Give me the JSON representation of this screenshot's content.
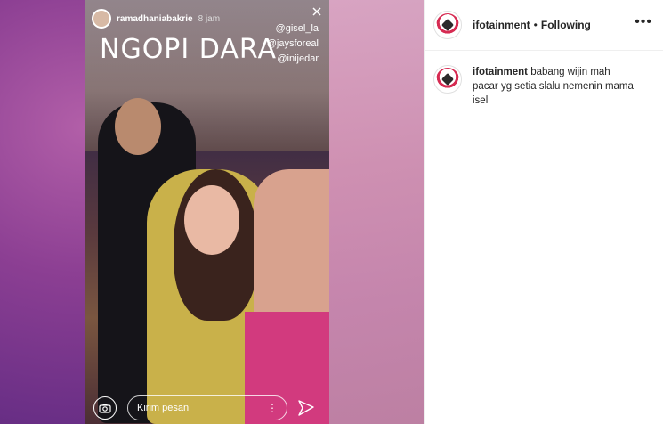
{
  "story": {
    "username": "ramadhaniabakrie",
    "time": "8 jam",
    "title": "NGOPI DARA",
    "tags": [
      "@gisel_la",
      "@jaysforeal",
      "@inijedar"
    ],
    "message_placeholder": "Kirim pesan"
  },
  "post": {
    "account": "ifotainment",
    "separator": "•",
    "follow_status": "Following",
    "caption_user": "ifotainment",
    "caption": "babang wijin mah pacar yg setia slalu nemenin mama isel"
  },
  "icons": {
    "header_more": "more-horizontal-icon",
    "camera": "camera-icon",
    "send": "send-icon",
    "story_more": "more-vertical-icon"
  },
  "colors": {
    "story_pink": "#d23a7e",
    "text": "#262626"
  }
}
